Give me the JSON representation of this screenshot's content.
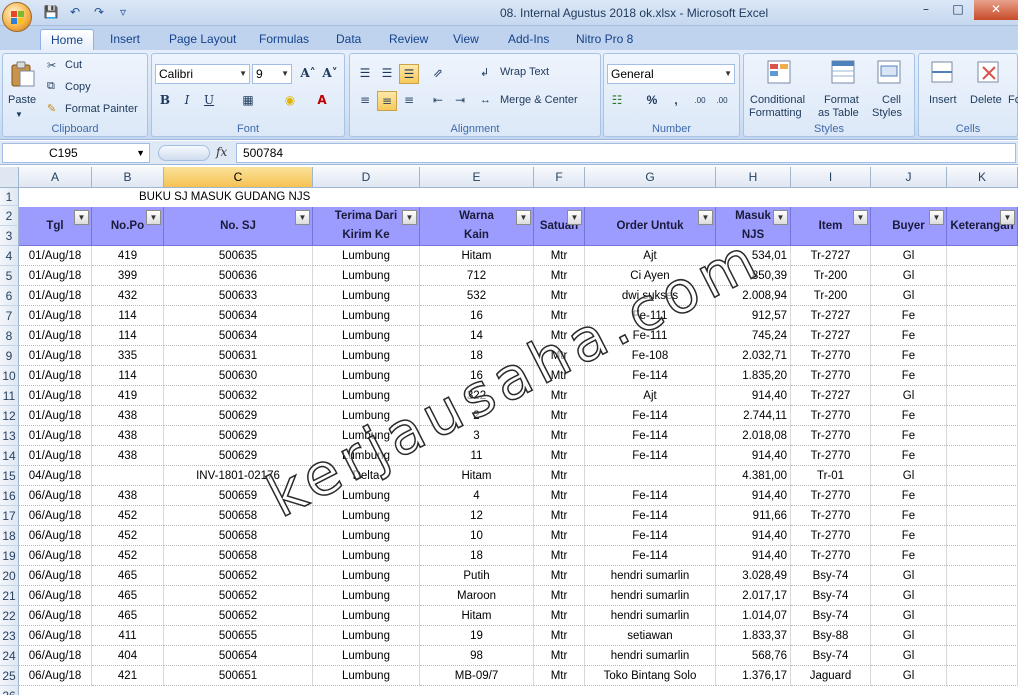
{
  "window": {
    "title": "08. Internal Agustus 2018 ok.xlsx - Microsoft Excel"
  },
  "qat": {
    "save": "💾",
    "undo": "↶",
    "redo": "↷",
    "more": "▿"
  },
  "tabs": [
    "Home",
    "Insert",
    "Page Layout",
    "Formulas",
    "Data",
    "Review",
    "View",
    "Add-Ins",
    "Nitro Pro 8"
  ],
  "ribbon": {
    "clipboard": {
      "paste": "Paste",
      "cut": "Cut",
      "copy": "Copy",
      "format_painter": "Format Painter",
      "label": "Clipboard"
    },
    "font": {
      "name": "Calibri",
      "size": "9",
      "grow": "A˄",
      "shrink": "A˅",
      "bold": "B",
      "italic": "I",
      "underline": "U",
      "label": "Font"
    },
    "alignment": {
      "wrap_text": "Wrap Text",
      "merge_center": "Merge & Center",
      "label": "Alignment"
    },
    "number": {
      "format": "General",
      "percent": "%",
      "comma": ",",
      "inc": ".00",
      "dec": ".00",
      "label": "Number"
    },
    "styles": {
      "conditional_1": "Conditional",
      "conditional_2": "Formatting",
      "format_1": "Format",
      "format_2": "as Table",
      "cell_1": "Cell",
      "cell_2": "Styles",
      "label": "Styles"
    },
    "cells": {
      "insert": "Insert",
      "delete": "Delete",
      "format": "Fo",
      "label": "Cells"
    }
  },
  "formula_bar": {
    "name_box": "C195",
    "fx": "fx",
    "value": "500784"
  },
  "columns": [
    "A",
    "B",
    "C",
    "D",
    "E",
    "F",
    "G",
    "H",
    "I",
    "J",
    "K"
  ],
  "sheet": {
    "title": "BUKU SJ MASUK GUDANG  NJS",
    "headers": {
      "tgl": "Tgl",
      "no_po": "No.Po",
      "no_sj": "No. SJ",
      "terima_1": "Terima Dari",
      "terima_2": "Kirim Ke",
      "warna_1": "Warna",
      "warna_2": "Kain",
      "satuan": "Satuan",
      "order_untuk": "Order Untuk",
      "masuk_1": "Masuk",
      "masuk_2": "NJS",
      "item": "Item",
      "buyer": "Buyer",
      "keterangan": "Keterangan"
    },
    "rows": [
      [
        "01/Aug/18",
        "419",
        "500635",
        "Lumbung",
        "Hitam",
        "Mtr",
        "Ajt",
        "534,01",
        "Tr-2727",
        "Gl",
        ""
      ],
      [
        "01/Aug/18",
        "399",
        "500636",
        "Lumbung",
        "712",
        "Mtr",
        "Ci Ayen",
        "850,39",
        "Tr-200",
        "Gl",
        ""
      ],
      [
        "01/Aug/18",
        "432",
        "500633",
        "Lumbung",
        "532",
        "Mtr",
        "dwi sukses",
        "2.008,94",
        "Tr-200",
        "Gl",
        ""
      ],
      [
        "01/Aug/18",
        "114",
        "500634",
        "Lumbung",
        "16",
        "Mtr",
        "Fe-111",
        "912,57",
        "Tr-2727",
        "Fe",
        ""
      ],
      [
        "01/Aug/18",
        "114",
        "500634",
        "Lumbung",
        "14",
        "Mtr",
        "Fe-111",
        "745,24",
        "Tr-2727",
        "Fe",
        ""
      ],
      [
        "01/Aug/18",
        "335",
        "500631",
        "Lumbung",
        "18",
        "Mtr",
        "Fe-108",
        "2.032,71",
        "Tr-2770",
        "Fe",
        ""
      ],
      [
        "01/Aug/18",
        "114",
        "500630",
        "Lumbung",
        "16",
        "Mtr",
        "Fe-114",
        "1.835,20",
        "Tr-2770",
        "Fe",
        ""
      ],
      [
        "01/Aug/18",
        "419",
        "500632",
        "Lumbung",
        "322",
        "Mtr",
        "Ajt",
        "914,40",
        "Tr-2727",
        "Gl",
        ""
      ],
      [
        "01/Aug/18",
        "438",
        "500629",
        "Lumbung",
        "2",
        "Mtr",
        "Fe-114",
        "2.744,11",
        "Tr-2770",
        "Fe",
        ""
      ],
      [
        "01/Aug/18",
        "438",
        "500629",
        "Lumbung",
        "3",
        "Mtr",
        "Fe-114",
        "2.018,08",
        "Tr-2770",
        "Fe",
        ""
      ],
      [
        "01/Aug/18",
        "438",
        "500629",
        "Lumbung",
        "11",
        "Mtr",
        "Fe-114",
        "914,40",
        "Tr-2770",
        "Fe",
        ""
      ],
      [
        "04/Aug/18",
        "",
        "INV-1801-02176",
        "Delta",
        "Hitam",
        "Mtr",
        "",
        "4.381,00",
        "Tr-01",
        "Gl",
        ""
      ],
      [
        "06/Aug/18",
        "438",
        "500659",
        "Lumbung",
        "4",
        "Mtr",
        "Fe-114",
        "914,40",
        "Tr-2770",
        "Fe",
        ""
      ],
      [
        "06/Aug/18",
        "452",
        "500658",
        "Lumbung",
        "12",
        "Mtr",
        "Fe-114",
        "911,66",
        "Tr-2770",
        "Fe",
        ""
      ],
      [
        "06/Aug/18",
        "452",
        "500658",
        "Lumbung",
        "10",
        "Mtr",
        "Fe-114",
        "914,40",
        "Tr-2770",
        "Fe",
        ""
      ],
      [
        "06/Aug/18",
        "452",
        "500658",
        "Lumbung",
        "18",
        "Mtr",
        "Fe-114",
        "914,40",
        "Tr-2770",
        "Fe",
        ""
      ],
      [
        "06/Aug/18",
        "465",
        "500652",
        "Lumbung",
        "Putih",
        "Mtr",
        "hendri sumarlin",
        "3.028,49",
        "Bsy-74",
        "Gl",
        ""
      ],
      [
        "06/Aug/18",
        "465",
        "500652",
        "Lumbung",
        "Maroon",
        "Mtr",
        "hendri sumarlin",
        "2.017,17",
        "Bsy-74",
        "Gl",
        ""
      ],
      [
        "06/Aug/18",
        "465",
        "500652",
        "Lumbung",
        "Hitam",
        "Mtr",
        "hendri sumarlin",
        "1.014,07",
        "Bsy-74",
        "Gl",
        ""
      ],
      [
        "06/Aug/18",
        "411",
        "500655",
        "Lumbung",
        "19",
        "Mtr",
        "setiawan",
        "1.833,37",
        "Bsy-88",
        "Gl",
        ""
      ],
      [
        "06/Aug/18",
        "404",
        "500654",
        "Lumbung",
        "98",
        "Mtr",
        "hendri sumarlin",
        "568,76",
        "Bsy-74",
        "Gl",
        ""
      ],
      [
        "06/Aug/18",
        "421",
        "500651",
        "Lumbung",
        "MB-09/7",
        "Mtr",
        "Toko Bintang Solo",
        "1.376,17",
        "Jaguard",
        "Gl",
        ""
      ]
    ]
  },
  "watermark": "kerjausaha.com"
}
